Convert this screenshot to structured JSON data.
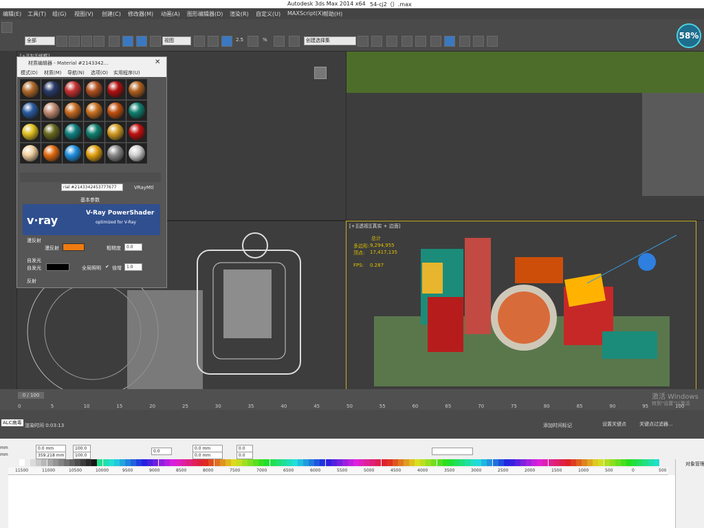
{
  "titlebar": {
    "app": "Autodesk 3ds Max  2014 x64",
    "file": "54-cj2（）.max"
  },
  "menubar": [
    "编辑(E)",
    "工具(T)",
    "组(G)",
    "视图(V)",
    "创建(C)",
    "修改器(M)",
    "动画(A)",
    "图形编辑器(D)",
    "渲染(R)",
    "自定义(U)",
    "MAXScript(X)",
    "帮助(H)"
  ],
  "toolbar": {
    "selection_filter": "全部",
    "view_dropdown": "视图",
    "named_selection": "创建选择集",
    "angle_snap": "2.5",
    "percent_snap": "%"
  },
  "badge": {
    "value": "58%"
  },
  "material_editor": {
    "title": "材质编辑器 - Material #2143342...",
    "menus": [
      "模式(D)",
      "材质(M)",
      "导航(N)",
      "选项(O)",
      "实用程序(U)"
    ],
    "material_name": "rial #2143342453777677",
    "material_type": "VRayMtl",
    "rollout": "基本参数",
    "vray_brand": "v·ray",
    "vray_title": "V-Ray PowerShader",
    "vray_subtitle": "optimized for V-Ray",
    "diffuse_section": "漫反射",
    "diffuse_label": "漫反射",
    "roughness_label": "粗糙度",
    "roughness_value": "0.0",
    "self_illum_section": "自发光",
    "self_illum_label": "自发光",
    "gi_label": "全局照明",
    "multiplier_label": "倍增",
    "multiplier_value": "1.0",
    "reflect_section": "反射"
  },
  "viewport_br": {
    "label": "[+][透视][真实 + 边面]",
    "stats_title": "总计",
    "polys_label": "多边形:",
    "polys_value": "9,294,955",
    "verts_label": "顶点:",
    "verts_value": "17,417,135",
    "fps_label": "FPS:",
    "fps_value": "0.287"
  },
  "viewport_tl": {
    "label": "[+][左][线框]"
  },
  "timeline": {
    "frame": "0 / 100",
    "ticks": [
      "0",
      "5",
      "10",
      "15",
      "20",
      "25",
      "30",
      "35",
      "40",
      "45",
      "50",
      "55",
      "60",
      "65",
      "70",
      "75",
      "80",
      "85",
      "90",
      "95",
      "100"
    ]
  },
  "statusbar": {
    "script": "ALC病毒",
    "render_time": "渲染时间 0:03:13",
    "add_time_tag": "添加时间标记",
    "set_key": "设置关键点",
    "key_filter": "关键点过滤器...",
    "activate": "激活 Windows",
    "goto_settings": "转到\"设置\"以激活"
  },
  "corel": {
    "w": "0.0 mm",
    "h": "359.218 mm",
    "mm1": "mm",
    "mm2": "mm",
    "scale1": "100.0",
    "scale2": "100.0",
    "pct": "%",
    "rot": "0.0",
    "x": "0.0 mm",
    "y": "0.0 mm",
    "o1": "0.0",
    "o2": "0.0",
    "object_panel": "对象管理",
    "ruler": [
      "11500",
      "11000",
      "10500",
      "10000",
      "9500",
      "9000",
      "8500",
      "8000",
      "7500",
      "7000",
      "6500",
      "6000",
      "5500",
      "5000",
      "4500",
      "4000",
      "3500",
      "3000",
      "2500",
      "2000",
      "1500",
      "1000",
      "500",
      "0",
      "500"
    ]
  },
  "chart_colors": {
    "accent": "#3a78c2",
    "viewport_border": "#c8b020",
    "stats": "#e0c000"
  }
}
